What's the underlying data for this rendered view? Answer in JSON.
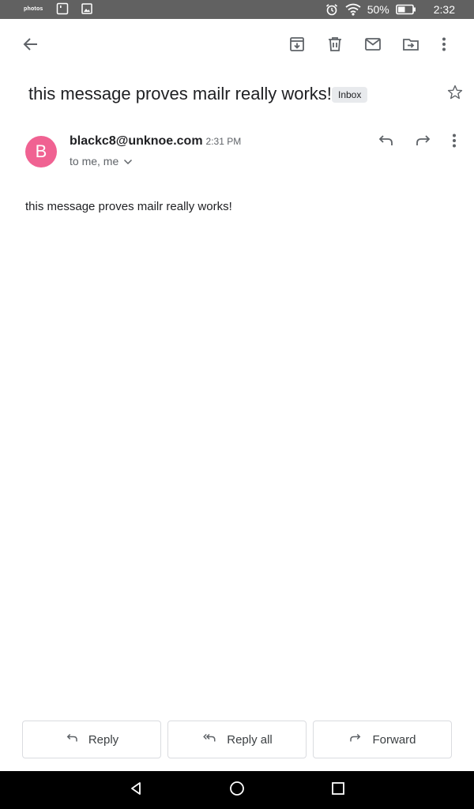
{
  "status_bar": {
    "notification_icons": [
      "photos-icon",
      "sim-card-icon",
      "image-icon"
    ],
    "photos_icon_text": "photos",
    "system_icons": [
      "alarm-icon",
      "wifi-icon",
      "battery-icon"
    ],
    "battery_percent": "50%",
    "battery_level": 0.5,
    "time": "2:32"
  },
  "toolbar": {
    "back_icon": "arrow-back-icon",
    "actions": [
      "archive-icon",
      "delete-icon",
      "mark-unread-icon",
      "move-to-icon",
      "more-vert-icon"
    ]
  },
  "message": {
    "subject": "this message proves mailr really works!",
    "label": "Inbox",
    "starred": false,
    "sender_initial": "B",
    "sender": "blackc8@unknoe.com",
    "time": "2:31 PM",
    "recipients": "to me, me",
    "body": "this message proves mailr really works!"
  },
  "actions": {
    "reply": "Reply",
    "reply_all": "Reply all",
    "forward": "Forward"
  },
  "colors": {
    "status_bar": "#616161",
    "avatar": "#f06292",
    "icon": "#5f6368",
    "chip": "#e8eaed",
    "button_border": "#dadce0"
  },
  "nav_bar": [
    "back-triangle-icon",
    "home-circle-icon",
    "recents-square-icon"
  ]
}
